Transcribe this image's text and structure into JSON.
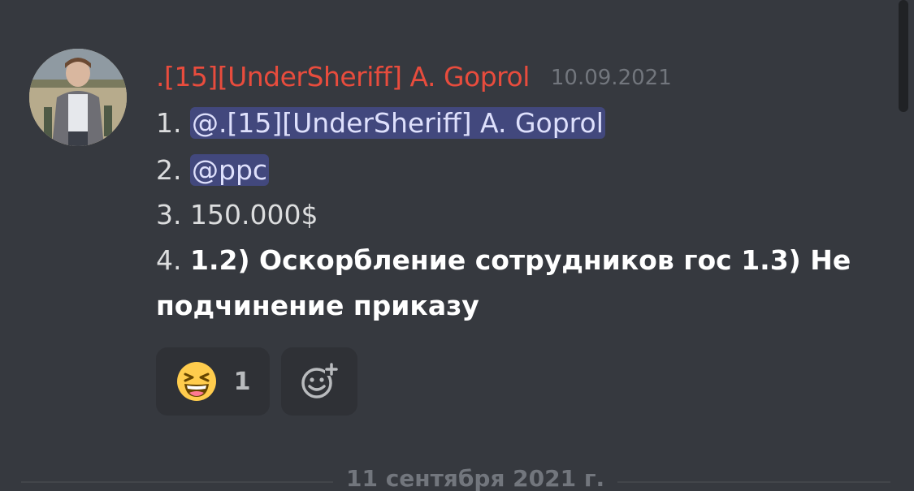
{
  "message": {
    "author": ".[15][UnderSheriff] A. Goprol",
    "timestamp": "10.09.2021",
    "lines": [
      {
        "num": "1.",
        "mention": "@.[15][UnderSheriff] A. Goprol"
      },
      {
        "num": "2.",
        "mention": "@ppc"
      },
      {
        "num": "3.",
        "text": "150.000$"
      },
      {
        "num": "4.",
        "bold": "1.2) Оскорбление сотрудников гос  1.3) Не"
      },
      {
        "bold": "подчинение приказу"
      }
    ]
  },
  "reactions": [
    {
      "emoji": "laughing-face",
      "count": "1"
    }
  ],
  "add_reaction_icon": "add-reaction-icon",
  "date_divider": "11 сентября 2021 г.",
  "colors": {
    "background": "#36393f",
    "author": "#e84c3d",
    "mention_bg": "#5865f2",
    "reaction_bg": "#2f3136"
  }
}
